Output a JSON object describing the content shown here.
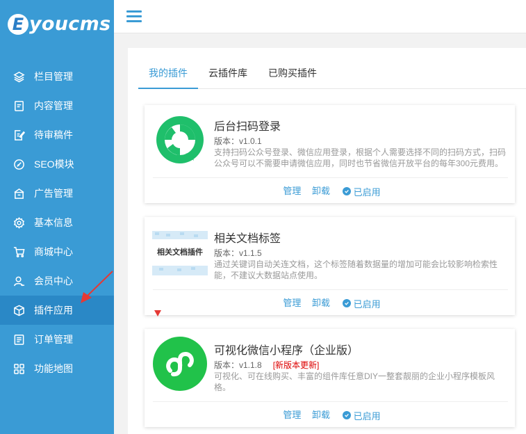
{
  "brand": {
    "badge": "E",
    "name": "youcms"
  },
  "sidebar": {
    "items": [
      {
        "label": "栏目管理",
        "icon": "layers-icon"
      },
      {
        "label": "内容管理",
        "icon": "document-icon"
      },
      {
        "label": "待审稿件",
        "icon": "edit-document-icon"
      },
      {
        "label": "SEO模块",
        "icon": "seo-icon"
      },
      {
        "label": "广告管理",
        "icon": "ad-icon"
      },
      {
        "label": "基本信息",
        "icon": "gear-icon"
      },
      {
        "label": "商城中心",
        "icon": "cart-icon"
      },
      {
        "label": "会员中心",
        "icon": "user-icon"
      },
      {
        "label": "插件应用",
        "icon": "plugin-cube-icon"
      },
      {
        "label": "订单管理",
        "icon": "order-icon"
      },
      {
        "label": "功能地图",
        "icon": "grid-icon"
      }
    ],
    "active_index": 8
  },
  "tabs": [
    {
      "label": "我的插件"
    },
    {
      "label": "云插件库"
    },
    {
      "label": "已购买插件"
    }
  ],
  "plugins": [
    {
      "title": "后台扫码登录",
      "version": "版本：v1.0.1",
      "update_badge": "",
      "description": "支持扫码公众号登录、微信应用登录，根据个人需要选择不同的扫码方式，扫码公众号可以不需要申请微信应用，同时也节省微信开放平台的每年300元费用。",
      "manage": "管理",
      "uninstall": "卸载",
      "status": "已启用"
    },
    {
      "title": "相关文档标签",
      "version": "版本：v1.1.5",
      "update_badge": "",
      "thumb_text": "相关文档插件",
      "description": "通过关键词自动关连文档，这个标签随着数据量的增加可能会比较影响检索性能，不建议大数据站点使用。",
      "manage": "管理",
      "uninstall": "卸载",
      "status": "已启用"
    },
    {
      "title": "可视化微信小程序（企业版）",
      "version": "版本：v1.1.8",
      "update_badge": "[新版本更新]",
      "description": "可视化、可在线购买、丰富的组件库任意DIY一整套靓丽的企业小程序模板风格。",
      "manage": "管理",
      "uninstall": "卸载",
      "status": "已启用"
    }
  ],
  "colors": {
    "sidebar": "#3a9bd5",
    "sidebar_active": "#2a88c6",
    "accent": "#3a9bd5",
    "update_red": "#d00000",
    "arrow_red": "#e53935"
  }
}
